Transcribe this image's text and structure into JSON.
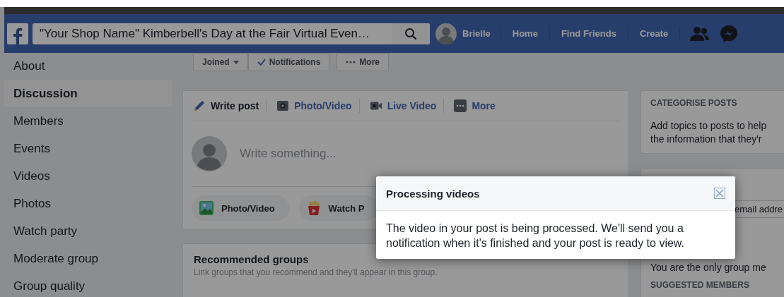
{
  "nav": {
    "search": {
      "value": "\"Your Shop Name\" Kimberbell's Day at the Fair Virtual Even…"
    },
    "user": "Brielle",
    "links": [
      "Home",
      "Find Friends",
      "Create"
    ]
  },
  "sidebar": {
    "items": [
      {
        "label": "About",
        "selected": false
      },
      {
        "label": "Discussion",
        "selected": true
      },
      {
        "label": "Members",
        "selected": false
      },
      {
        "label": "Events",
        "selected": false
      },
      {
        "label": "Videos",
        "selected": false
      },
      {
        "label": "Photos",
        "selected": false
      },
      {
        "label": "Watch party",
        "selected": false
      },
      {
        "label": "Moderate group",
        "selected": false
      },
      {
        "label": "Group quality",
        "selected": false
      }
    ]
  },
  "group_actions": [
    {
      "label": "Joined",
      "kind": "dropdown"
    },
    {
      "label": "Notifications",
      "kind": "check"
    },
    {
      "label": "More",
      "kind": "more"
    }
  ],
  "composer": {
    "tabs": [
      {
        "label": "Write post",
        "selected": true,
        "kind": "pencil"
      },
      {
        "label": "Photo/Video",
        "selected": false,
        "kind": "camera"
      },
      {
        "label": "Live Video",
        "selected": false,
        "kind": "live"
      },
      {
        "label": "More",
        "selected": false,
        "kind": "more"
      }
    ],
    "placeholder": "Write something...",
    "actions": [
      {
        "label": "Photo/Video",
        "kind": "photo"
      },
      {
        "label": "Watch P",
        "kind": "popcorn"
      }
    ]
  },
  "recommended": {
    "title": "Recommended groups",
    "subtitle": "Link groups that you recommend and they'll appear in this group."
  },
  "right": {
    "categorise": {
      "title": "CATEGORISE POSTS",
      "lines": [
        "Add topics to posts to help",
        "the information that they'r"
      ]
    },
    "invite": {
      "placeholder": "email addre",
      "note": "You are the only group me",
      "suggested": "SUGGESTED MEMBERS"
    }
  },
  "dialog": {
    "title": "Processing videos",
    "body": "The video in your post is being processed. We'll send you a notification when it's finished and your post is ready to view."
  }
}
